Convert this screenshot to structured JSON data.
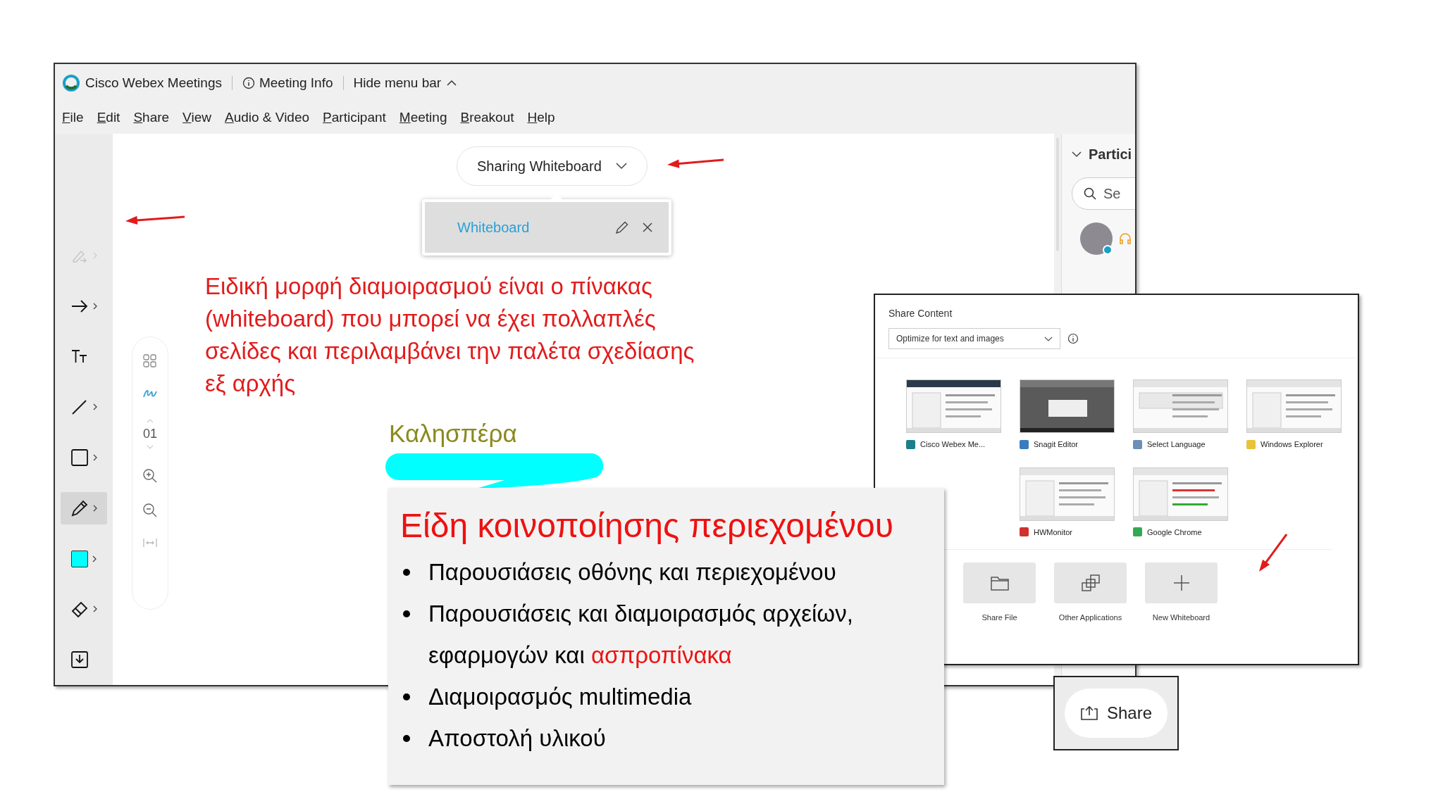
{
  "webex": {
    "app_title": "Cisco Webex Meetings",
    "meeting_info": "Meeting Info",
    "hide_menu_bar": "Hide menu bar",
    "menu": [
      "File",
      "Edit",
      "Share",
      "View",
      "Audio & Video",
      "Participant",
      "Meeting",
      "Breakout",
      "Help"
    ],
    "sharing_pill": "Sharing Whiteboard",
    "whiteboard_tab": {
      "label": "Whiteboard",
      "selected": true
    },
    "tools": [
      {
        "kind": "pointer",
        "selected": false,
        "disabled": true
      },
      {
        "kind": "arrow",
        "selected": false,
        "disabled": false
      },
      {
        "kind": "text",
        "selected": false,
        "disabled": false
      },
      {
        "kind": "line",
        "selected": false,
        "disabled": false
      },
      {
        "kind": "rectangle",
        "selected": false,
        "disabled": false
      },
      {
        "kind": "pen",
        "selected": true,
        "disabled": false
      },
      {
        "kind": "color",
        "selected": false,
        "disabled": false,
        "color": "#00ffff"
      },
      {
        "kind": "eraser",
        "selected": false,
        "disabled": false
      },
      {
        "kind": "save",
        "selected": false,
        "disabled": false
      }
    ],
    "page_number": "01",
    "participants": {
      "title": "Partici",
      "search_placeholder": "Se"
    },
    "annotation": "Ειδική μορφή διαμοιρασμού είναι ο πίνακας\n(whiteboard) που μπορεί να έχει πολλαπλές\nσελίδες και  περιλαμβάνει την παλέτα σχεδίασης\nεξ αρχής",
    "greeting": "Καλησπέρα"
  },
  "share_content": {
    "title": "Share Content",
    "optimize": "Optimize for text and images",
    "apps": [
      {
        "label": "Cisco Webex Me...",
        "color": "#1a7f8c"
      },
      {
        "label": "Snagit Editor",
        "color": "#3a7bbf"
      },
      {
        "label": "Select Language",
        "color": "#6b8fb5"
      },
      {
        "label": "Windows Explorer",
        "color": "#e8c23a"
      },
      {
        "label": "HWMonitor",
        "color": "#d0312d"
      },
      {
        "label": "Google Chrome",
        "color": "#34a853"
      }
    ],
    "actions": [
      {
        "kind": "file",
        "label": "Share File"
      },
      {
        "kind": "apps",
        "label": "Other Applications"
      },
      {
        "kind": "new",
        "label": "New Whiteboard"
      }
    ]
  },
  "summary": {
    "title": "Είδη κοινοποίησης περιεχομένου",
    "items": [
      {
        "segments": [
          {
            "text": "Παρουσιάσεις οθόνης και περιεχομένου",
            "highlight": false
          }
        ]
      },
      {
        "segments": [
          {
            "text": "Παρουσιάσεις και διαμοιρασμός αρχείων, εφαρμογών και ",
            "highlight": false
          },
          {
            "text": "ασπροπίνακα",
            "highlight": true
          }
        ]
      },
      {
        "segments": [
          {
            "text": "Διαμοιρασμός multimedia",
            "highlight": false
          }
        ]
      },
      {
        "segments": [
          {
            "text": "Αποστολή υλικού",
            "highlight": false
          }
        ]
      }
    ]
  },
  "share_button": {
    "label": "Share"
  }
}
